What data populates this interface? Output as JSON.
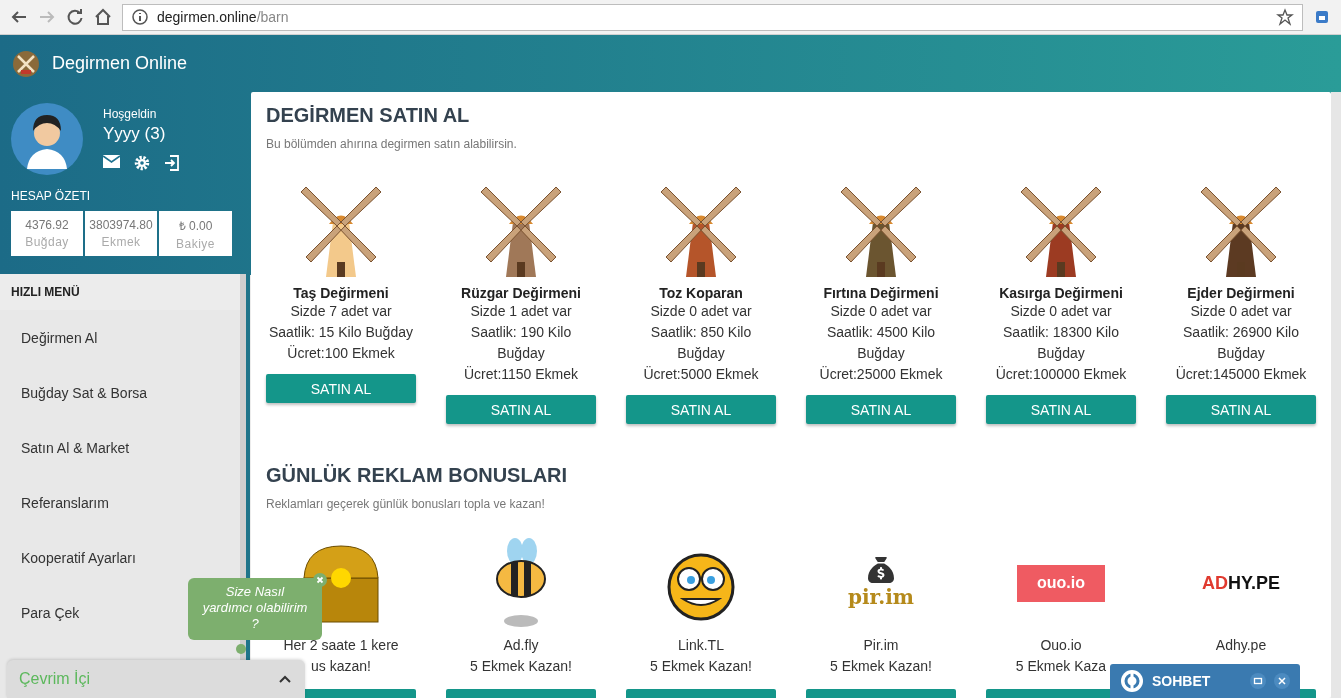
{
  "browser": {
    "domain": "degirmen.online",
    "path": "/barn"
  },
  "brand": {
    "title": "Degirmen Online"
  },
  "profile": {
    "greeting": "Hoşgeldin",
    "username": "Yyyy (3)"
  },
  "account_summary": {
    "title": "HESAP ÖZETI",
    "stats": [
      {
        "value": "4376.92",
        "label": "Buğday"
      },
      {
        "value": "3803974.80",
        "label": "Ekmek"
      },
      {
        "value": "₺ 0.00",
        "label": "Bakiye"
      }
    ]
  },
  "quick_menu": {
    "title": "HIZLI MENÜ",
    "items": [
      {
        "label": "Değirmen Al",
        "selected": false
      },
      {
        "label": "Buğday Sat & Borsa",
        "selected": false
      },
      {
        "label": "Satın Al & Market",
        "selected": false
      },
      {
        "label": "Referanslarım",
        "selected": false
      },
      {
        "label": "Kooperatif Ayarları",
        "selected": false
      },
      {
        "label": "Para Çek",
        "selected": false
      }
    ]
  },
  "mill_section": {
    "title": "DEGİRMEN SATIN AL",
    "subtitle": "Bu bölümden ahırına degirmen satın alabilirsin.",
    "mills": [
      {
        "name": "Taş Değirmeni",
        "owned": "Sizde 7 adet var",
        "production": "Saatlik: 15 Kilo Buğday",
        "price": "Ücret:100 Ekmek",
        "button": "SATIN AL"
      },
      {
        "name": "Rüzgar Değirmeni",
        "owned": "Sizde 1 adet var",
        "production": "Saatlik: 190 Kilo Buğday",
        "price": "Ücret:1150 Ekmek",
        "button": "SATIN AL"
      },
      {
        "name": "Toz Koparan",
        "owned": "Sizde 0 adet var",
        "production": "Saatlik: 850 Kilo Buğday",
        "price": "Ücret:5000 Ekmek",
        "button": "SATIN AL"
      },
      {
        "name": "Fırtına Değirmeni",
        "owned": "Sizde 0 adet var",
        "production": "Saatlik: 4500 Kilo Buğday",
        "price": "Ücret:25000 Ekmek",
        "button": "SATIN AL"
      },
      {
        "name": "Kasırga Değirmeni",
        "owned": "Sizde 0 adet var",
        "production": "Saatlik: 18300 Kilo Buğday",
        "price": "Ücret:100000 Ekmek",
        "button": "SATIN AL"
      },
      {
        "name": "Ejder Değirmeni",
        "owned": "Sizde 0 adet var",
        "production": "Saatlik: 26900 Kilo Buğday",
        "price": "Ücret:145000 Ekmek",
        "button": "SATIN AL"
      }
    ]
  },
  "bonus_section": {
    "title": "GÜNLÜK REKLAM BONUSLARI",
    "subtitle": "Reklamları geçerek günlük bonusları topla ve kazan!",
    "bonuses": [
      {
        "kind": "chest",
        "lines": [
          "Her 2 saate 1 kere",
          "us kazan!"
        ]
      },
      {
        "kind": "bee",
        "lines": [
          "Ad.fly",
          "5 Ekmek Kazan!"
        ]
      },
      {
        "kind": "monster",
        "lines": [
          "Link.TL",
          "5 Ekmek Kazan!"
        ]
      },
      {
        "kind": "pirim",
        "logo": [
          "pir.im"
        ],
        "lines": [
          "Pir.im",
          "5 Ekmek Kazan!"
        ]
      },
      {
        "kind": "ouo",
        "logo": [
          "ouo.io"
        ],
        "lines": [
          "Ouo.io",
          "5 Ekmek Kaza"
        ]
      },
      {
        "kind": "adhype",
        "logo": [
          "AD",
          "HY.PE"
        ],
        "lines": [
          "Adhy.pe"
        ]
      }
    ]
  },
  "help_bubble": {
    "text": "Size Nasıl yardımcı olabilirim ?"
  },
  "online_bar": {
    "label": "Çevrim İçi"
  },
  "chat": {
    "title": "SOHBET"
  }
}
